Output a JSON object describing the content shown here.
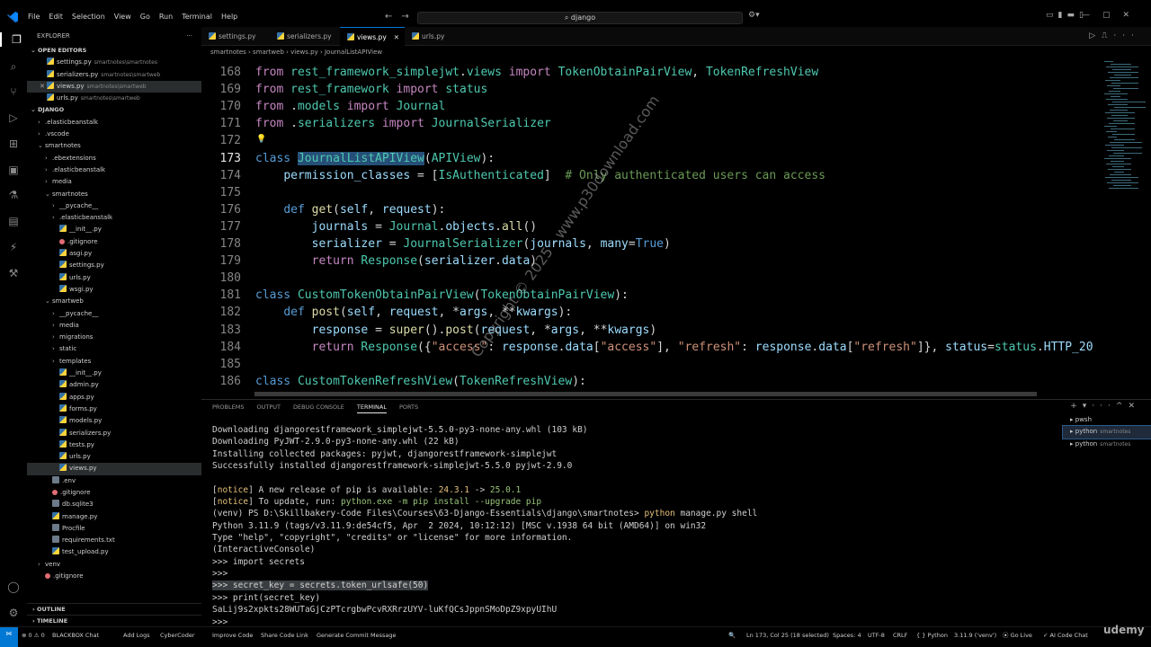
{
  "titlebar": {
    "menus": [
      "File",
      "Edit",
      "Selection",
      "View",
      "Go",
      "Run",
      "Terminal",
      "Help"
    ],
    "search": "django"
  },
  "sidebar": {
    "title": "EXPLORER",
    "open_editors_label": "OPEN EDITORS",
    "open_editors": [
      {
        "name": "settings.py",
        "hint": "smartnotes\\smartnotes"
      },
      {
        "name": "serializers.py",
        "hint": "smartnotes\\smartweb"
      },
      {
        "name": "views.py",
        "hint": "smartnotes\\smartweb"
      },
      {
        "name": "urls.py",
        "hint": "smartnotes\\smartweb"
      }
    ],
    "project_label": "DJANGO",
    "tree": [
      {
        "name": ".elasticbeanstalk",
        "indent": 1,
        "type": "folder",
        "chev": "›"
      },
      {
        "name": ".vscode",
        "indent": 1,
        "type": "folder",
        "chev": "›"
      },
      {
        "name": "smartnotes",
        "indent": 1,
        "type": "folder",
        "chev": "⌄"
      },
      {
        "name": ".ebextensions",
        "indent": 2,
        "type": "folder",
        "chev": "›"
      },
      {
        "name": ".elasticbeanstalk",
        "indent": 2,
        "type": "folder",
        "chev": "›"
      },
      {
        "name": "media",
        "indent": 2,
        "type": "folder",
        "chev": "›"
      },
      {
        "name": "smartnotes",
        "indent": 2,
        "type": "folder",
        "chev": "⌄"
      },
      {
        "name": "__pycache__",
        "indent": 3,
        "type": "folder",
        "chev": "›"
      },
      {
        "name": ".elasticbeanstalk",
        "indent": 3,
        "type": "folder",
        "chev": "›"
      },
      {
        "name": "__init__.py",
        "indent": 3,
        "type": "py"
      },
      {
        "name": ".gitignore",
        "indent": 3,
        "type": "dot"
      },
      {
        "name": "asgi.py",
        "indent": 3,
        "type": "py"
      },
      {
        "name": "settings.py",
        "indent": 3,
        "type": "py"
      },
      {
        "name": "urls.py",
        "indent": 3,
        "type": "py"
      },
      {
        "name": "wsgi.py",
        "indent": 3,
        "type": "py"
      },
      {
        "name": "smartweb",
        "indent": 2,
        "type": "folder",
        "chev": "⌄"
      },
      {
        "name": "__pycache__",
        "indent": 3,
        "type": "folder",
        "chev": "›"
      },
      {
        "name": "media",
        "indent": 3,
        "type": "folder",
        "chev": "›"
      },
      {
        "name": "migrations",
        "indent": 3,
        "type": "folder",
        "chev": "›"
      },
      {
        "name": "static",
        "indent": 3,
        "type": "folder",
        "chev": "›"
      },
      {
        "name": "templates",
        "indent": 3,
        "type": "folder",
        "chev": "›"
      },
      {
        "name": "__init__.py",
        "indent": 3,
        "type": "py"
      },
      {
        "name": "admin.py",
        "indent": 3,
        "type": "py"
      },
      {
        "name": "apps.py",
        "indent": 3,
        "type": "py"
      },
      {
        "name": "forms.py",
        "indent": 3,
        "type": "py"
      },
      {
        "name": "models.py",
        "indent": 3,
        "type": "py"
      },
      {
        "name": "serializers.py",
        "indent": 3,
        "type": "py"
      },
      {
        "name": "tests.py",
        "indent": 3,
        "type": "py"
      },
      {
        "name": "urls.py",
        "indent": 3,
        "type": "py"
      },
      {
        "name": "views.py",
        "indent": 3,
        "type": "py",
        "selected": true
      },
      {
        "name": ".env",
        "indent": 2,
        "type": "txt"
      },
      {
        "name": ".gitignore",
        "indent": 2,
        "type": "dot"
      },
      {
        "name": "db.sqlite3",
        "indent": 2,
        "type": "txt"
      },
      {
        "name": "manage.py",
        "indent": 2,
        "type": "py"
      },
      {
        "name": "Procfile",
        "indent": 2,
        "type": "txt"
      },
      {
        "name": "requirements.txt",
        "indent": 2,
        "type": "txt"
      },
      {
        "name": "test_upload.py",
        "indent": 2,
        "type": "py"
      },
      {
        "name": "venv",
        "indent": 1,
        "type": "folder",
        "chev": "›"
      },
      {
        "name": ".gitignore",
        "indent": 1,
        "type": "dot"
      }
    ],
    "outline_label": "OUTLINE",
    "timeline_label": "TIMELINE"
  },
  "tabs": [
    "settings.py",
    "serializers.py",
    "views.py",
    "urls.py"
  ],
  "active_tab": "views.py",
  "breadcrumb": [
    "smartnotes",
    "smartweb",
    "views.py",
    "JournalListAPIView"
  ],
  "editor": {
    "current_line": 173,
    "lines": [
      {
        "n": 168,
        "html": "<span class=\"kw\">from</span> <span class=\"cls\">rest_framework_simplejwt</span>.<span class=\"cls\">views</span> <span class=\"kw\">import</span> <span class=\"cls\">TokenObtainPairView</span>, <span class=\"cls\">TokenRefreshView</span>"
      },
      {
        "n": 169,
        "html": "<span class=\"kw\">from</span> <span class=\"cls\">rest_framework</span> <span class=\"kw\">import</span> <span class=\"cls\">status</span>"
      },
      {
        "n": 170,
        "html": "<span class=\"kw\">from</span> .<span class=\"cls\">models</span> <span class=\"kw\">import</span> <span class=\"cls\">Journal</span>"
      },
      {
        "n": 171,
        "html": "<span class=\"kw\">from</span> .<span class=\"cls\">serializers</span> <span class=\"kw\">import</span> <span class=\"cls\">JournalSerializer</span>"
      },
      {
        "n": 172,
        "html": ""
      },
      {
        "n": 173,
        "html": "<span class=\"kw2\">class</span> <span class=\"cls sel\">JournalListAPIView</span>(<span class=\"cls\">APIView</span>):"
      },
      {
        "n": 174,
        "html": "    <span class=\"var\">permission_classes</span> = [<span class=\"cls\">IsAuthenticated</span>]  <span class=\"cmt\"># Only authenticated users can access</span>"
      },
      {
        "n": 175,
        "html": ""
      },
      {
        "n": 176,
        "html": "    <span class=\"kw2\">def</span> <span class=\"fn\">get</span>(<span class=\"var\">self</span>, <span class=\"var\">request</span>):"
      },
      {
        "n": 177,
        "html": "        <span class=\"var\">journals</span> = <span class=\"cls\">Journal</span>.<span class=\"var\">objects</span>.<span class=\"fn\">all</span>()"
      },
      {
        "n": 178,
        "html": "        <span class=\"var\">serializer</span> = <span class=\"cls\">JournalSerializer</span>(<span class=\"var\">journals</span>, <span class=\"var\">many</span>=<span class=\"kw2\">True</span>)"
      },
      {
        "n": 179,
        "html": "        <span class=\"kw\">return</span> <span class=\"cls\">Response</span>(<span class=\"var\">serializer</span>.<span class=\"var\">data</span>)"
      },
      {
        "n": 180,
        "html": ""
      },
      {
        "n": 181,
        "html": "<span class=\"kw2\">class</span> <span class=\"cls\">CustomTokenObtainPairView</span>(<span class=\"cls\">TokenObtainPairView</span>):"
      },
      {
        "n": 182,
        "html": "    <span class=\"kw2\">def</span> <span class=\"fn\">post</span>(<span class=\"var\">self</span>, <span class=\"var\">request</span>, *<span class=\"var\">args</span>, **<span class=\"var\">kwargs</span>):"
      },
      {
        "n": 183,
        "html": "        <span class=\"var\">response</span> = <span class=\"fn\">super</span>().<span class=\"fn\">post</span>(<span class=\"var\">request</span>, *<span class=\"var\">args</span>, **<span class=\"var\">kwargs</span>)"
      },
      {
        "n": 184,
        "html": "        <span class=\"kw\">return</span> <span class=\"cls\">Response</span>({<span class=\"str\">\"access\"</span>: <span class=\"var\">response</span>.<span class=\"var\">data</span>[<span class=\"str\">\"access\"</span>], <span class=\"str\">\"refresh\"</span>: <span class=\"var\">response</span>.<span class=\"var\">data</span>[<span class=\"str\">\"refresh\"</span>]}, <span class=\"var\">status</span>=<span class=\"cls\">status</span>.<span class=\"var\">HTTP_20</span>"
      },
      {
        "n": 185,
        "html": ""
      },
      {
        "n": 186,
        "html": "<span class=\"kw2\">class</span> <span class=\"cls\">CustomTokenRefreshView</span>(<span class=\"cls\">TokenRefreshView</span>):"
      }
    ]
  },
  "panel": {
    "tabs": [
      "PROBLEMS",
      "OUTPUT",
      "DEBUG CONSOLE",
      "TERMINAL",
      "PORTS"
    ],
    "active_tab": "TERMINAL",
    "terminal_lines": [
      {
        "text": "Downloading djangorestframework_simplejwt-5.5.0-py3-none-any.whl (103 kB)"
      },
      {
        "text": "Downloading PyJWT-2.9.0-py3-none-any.whl (22 kB)"
      },
      {
        "text": "Installing collected packages: pyjwt, djangorestframework-simplejwt"
      },
      {
        "text": "Successfully installed djangorestframework-simplejwt-5.5.0 pyjwt-2.9.0"
      },
      {
        "text": ""
      },
      {
        "html": "[<span class=\"tyellow\">notice</span>] A new release of pip is available: <span class=\"tyellow\">24.3.1</span> -&gt; <span class=\"tgreen\">25.0.1</span>"
      },
      {
        "html": "[<span class=\"tyellow\">notice</span>] To update, run: <span class=\"tgreen\">python.exe -m pip install --upgrade pip</span>"
      },
      {
        "html": "(venv) PS D:\\Skillbakery-Code Files\\Courses\\63-Django-Essentials\\django\\smartnotes&gt; <span class=\"tyellow\">python</span> manage.py shell"
      },
      {
        "text": "Python 3.11.9 (tags/v3.11.9:de54cf5, Apr  2 2024, 10:12:12) [MSC v.1938 64 bit (AMD64)] on win32"
      },
      {
        "text": "Type \"help\", \"copyright\", \"credits\" or \"license\" for more information."
      },
      {
        "text": "(InteractiveConsole)"
      },
      {
        "text": ">>> import secrets"
      },
      {
        "text": ">>>"
      },
      {
        "html": "<span class=\"tsel\">&gt;&gt;&gt; secret_key = secrets.token_urlsafe(50)</span>"
      },
      {
        "text": ">>> print(secret_key)"
      },
      {
        "text": "SaLij9s2xpkts28WUTaGjCzPTcrgbwPcvRXRrzUYV-luKfQCsJppnSMoDpZ9xpyUIhU"
      },
      {
        "text": ">>> "
      }
    ],
    "terminals": [
      {
        "name": "pwsh",
        "hint": ""
      },
      {
        "name": "python",
        "hint": "smartnotes",
        "selected": true
      },
      {
        "name": "python",
        "hint": "smartnotes"
      }
    ]
  },
  "status": {
    "errors": "0",
    "warnings": "0",
    "items_left": [
      "BLACKBOX Chat",
      "Add Logs",
      "CyberCoder",
      "Improve Code",
      "Share Code Link",
      "Generate Commit Message"
    ],
    "position": "Ln 173, Col 25 (18 selected)",
    "spaces": "Spaces: 4",
    "encoding": "UTF-8",
    "eol": "CRLF",
    "language": "Python",
    "interpreter": "3.11.9 ('venv')",
    "golive": "Go Live",
    "ai_chat": "AI Code Chat"
  },
  "watermark": "Copyright © 2025 - www.p30download.com",
  "brand": "udemy"
}
